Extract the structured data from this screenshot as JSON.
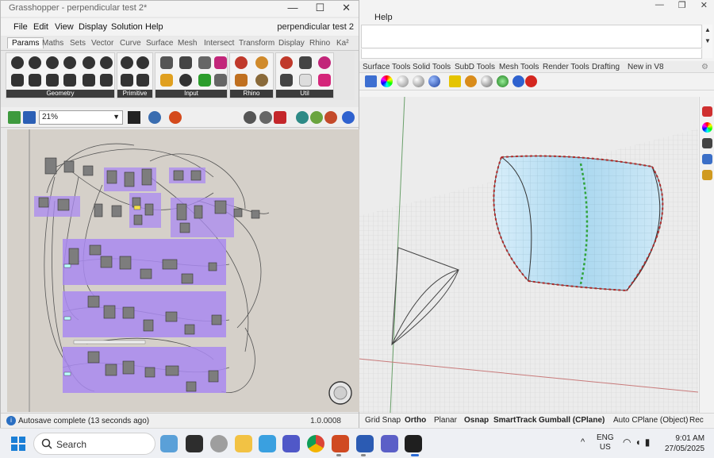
{
  "rhino": {
    "menu_help": "Help",
    "tabs": [
      "Surface Tools",
      "Solid Tools",
      "SubD Tools",
      "Mesh Tools",
      "Render Tools",
      "Drafting",
      "New in V8"
    ],
    "status": [
      "Grid Snap",
      "Ortho",
      "Planar",
      "Osnap",
      "SmartTrack",
      "Gumball (CPlane)",
      "Auto CPlane (Object)",
      "Rec"
    ],
    "window_controls": [
      "—",
      "❐",
      "✕"
    ]
  },
  "gh": {
    "title": "Grasshopper - perpendicular test 2*",
    "doc_name": "perpendicular test 2",
    "menu": [
      "File",
      "Edit",
      "View",
      "Display",
      "Solution",
      "Help"
    ],
    "tabs": [
      "Params",
      "Maths",
      "Sets",
      "Vector",
      "Curve",
      "Surface",
      "Mesh",
      "Intersect",
      "Transform",
      "Display",
      "Rhino",
      "Ka²"
    ],
    "active_tab": "Params",
    "panels": [
      "Geometry",
      "Primitive",
      "Input",
      "Rhino",
      "Util"
    ],
    "zoom": "21%",
    "status": "Autosave complete (13 seconds ago)",
    "version": "1.0.0008",
    "window_controls": [
      "—",
      "☐",
      "✕"
    ]
  },
  "taskbar": {
    "search_label": "Search",
    "lang_top": "ENG",
    "lang_bottom": "US",
    "time": "9:01 AM",
    "date": "27/05/2025",
    "tray_chevron": "^"
  },
  "colors": {
    "surface": "#bfe3f4",
    "canvas": "#d5d0c9",
    "group": "#a989f0",
    "control_red": "#b02a2a",
    "control_green": "#2fa33a"
  }
}
